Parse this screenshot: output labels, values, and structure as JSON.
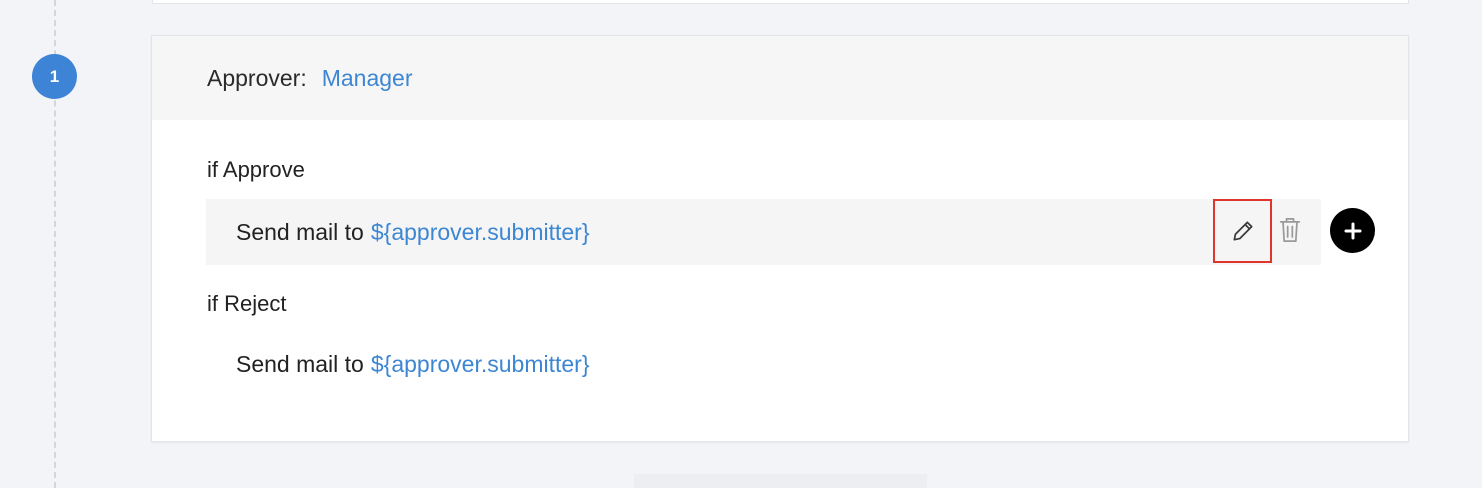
{
  "step": {
    "number": "1"
  },
  "approver": {
    "label": "Approver:",
    "value": "Manager"
  },
  "approve_section": {
    "title": "if Approve",
    "action": {
      "prefix": "Send mail to",
      "variable": "${approver.submitter}"
    }
  },
  "reject_section": {
    "title": "if Reject",
    "action": {
      "prefix": "Send mail to",
      "variable": "${approver.submitter}"
    }
  },
  "icons": {
    "edit": "pencil-icon",
    "delete": "trash-icon",
    "add": "plus-icon"
  },
  "colors": {
    "accent": "#3d86d2",
    "step_badge": "#3d83d6",
    "highlight_border": "#e0352b",
    "add_button": "#000000"
  }
}
